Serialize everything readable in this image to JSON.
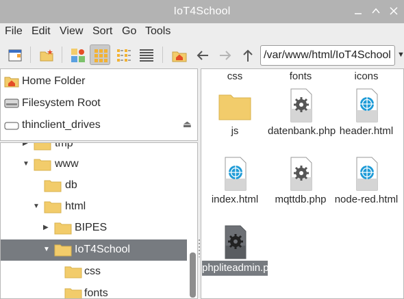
{
  "window": {
    "title": "IoT4School"
  },
  "menubar": {
    "items": [
      "File",
      "Edit",
      "View",
      "Sort",
      "Go",
      "Tools"
    ]
  },
  "toolbar": {
    "path": "/var/www/html/IoT4School"
  },
  "places": [
    {
      "label": "Home Folder",
      "icon": "home-folder-icon"
    },
    {
      "label": "Filesystem Root",
      "icon": "drive-icon"
    },
    {
      "label": "thinclient_drives",
      "icon": "drive-icon"
    }
  ],
  "tree": [
    {
      "label": "tmp",
      "expanded": false
    },
    {
      "label": "www",
      "expanded": true
    },
    {
      "label": "db",
      "expanded": false
    },
    {
      "label": "html",
      "expanded": true
    },
    {
      "label": "BIPES",
      "expanded": false
    },
    {
      "label": "IoT4School",
      "expanded": true,
      "selected": true
    },
    {
      "label": "css",
      "expanded": false
    },
    {
      "label": "fonts",
      "expanded": false
    }
  ],
  "files": {
    "partial_row": [
      "css",
      "fonts",
      "icons"
    ],
    "items": [
      {
        "name": "js",
        "type": "folder"
      },
      {
        "name": "datenbank.php",
        "type": "php"
      },
      {
        "name": "header.html",
        "type": "html"
      },
      {
        "name": "index.html",
        "type": "html"
      },
      {
        "name": "mqttdb.php",
        "type": "php"
      },
      {
        "name": "node-red.html",
        "type": "html"
      },
      {
        "name": "phpliteadmin.php",
        "type": "php",
        "selected": true
      }
    ]
  },
  "colors": {
    "titlebar": "#b3b3b3",
    "selection": "#777b80",
    "folder": "#f2cc6b"
  }
}
